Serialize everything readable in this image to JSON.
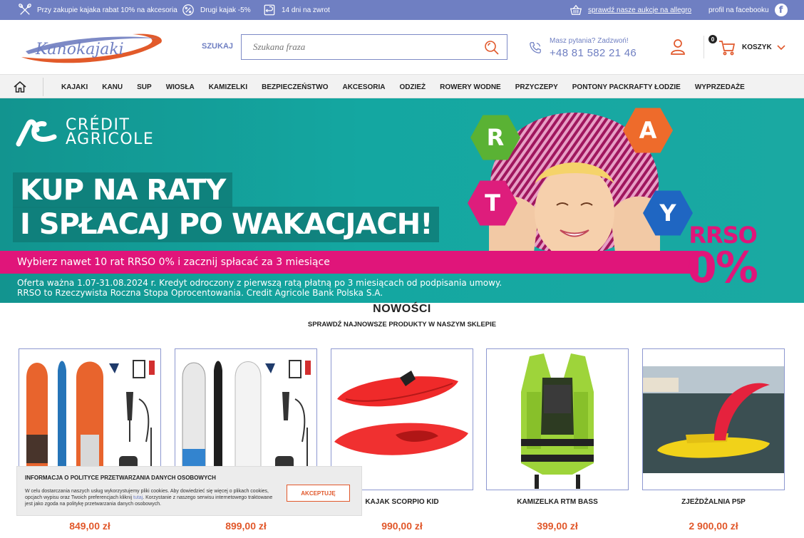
{
  "topbar": {
    "promo1": "Przy zakupie kajaka rabat 10% na akcesoria",
    "promo2": "Drugi kajak -5%",
    "promo3": "14 dni na zwrot",
    "allegro": "sprawdź nasze aukcje na allegro",
    "facebook": "profil na facebooku",
    "bg_color": "#6f7fc2"
  },
  "header": {
    "logo_text": "Kanokajaki",
    "search_label": "SZUKAJ",
    "search_placeholder": "Szukana fraza",
    "phone_question": "Masz pytania? Zadzwoń!",
    "phone_number": "+48 81 582 21 46",
    "cart_count": "0",
    "cart_label": "KOSZYK"
  },
  "nav": {
    "items": [
      "KAJAKI",
      "KANU",
      "SUP",
      "WIOSŁA",
      "KAMIZELKI",
      "BEZPIECZEŃSTWO",
      "AKCESORIA",
      "ODZIEŻ",
      "ROWERY WODNE",
      "PRZYCZEPY",
      "PONTONY PACKRAFTY ŁODZIE",
      "WYPRZEDAŻE"
    ]
  },
  "banner": {
    "brand_line1": "CRÉDIT",
    "brand_line2": "AGRICOLE",
    "headline1": "KUP NA RATY",
    "headline2": "I SPŁACAJ PO WAKACJACH!",
    "pink_text": "Wybierz nawet 10 rat RRSO 0% i zacznij spłacać za 3 miesiące",
    "fine_line1": "Oferta ważna 1.07-31.08.2024 r. Kredyt odroczony z pierwszą ratą płatną po 3 miesiącach od podpisania umowy.",
    "fine_line2": "RRSO to Rzeczywista Roczna Stopa Oprocentowania. Credit Agricole Bank Polska S.A.",
    "hex_letters": [
      "R",
      "A",
      "T",
      "Y"
    ],
    "rrso_label": "RRSO",
    "rrso_value": "0%"
  },
  "section": {
    "title": "NOWOŚCI",
    "subtitle": "SPRAWDŹ NAJNOWSZE PRODUKTY W NASZYM SKLEPIE"
  },
  "products": [
    {
      "name": "",
      "price": "849,00 zł"
    },
    {
      "name": "",
      "price": "899,00 zł"
    },
    {
      "name": "KAJAK SCORPIO KID",
      "price": "990,00 zł"
    },
    {
      "name": "KAMIZELKA RTM BASS",
      "price": "399,00 zł"
    },
    {
      "name": "ZJEŻDŻALNIA P5P",
      "price": "2 900,00 zł"
    }
  ],
  "cookie": {
    "title": "INFORMACJA O POLITYCE PRZETWARZANIA DANYCH OSOBOWYCH",
    "text_a": "W celu dostarczania naszych usług wykorzystujemy pliki cookies. Aby dowiedzieć się więcej o plikach cookies, opcjach wypisu oraz Twoich preferencjach kliknij ",
    "text_link": "tutaj",
    "text_b": ". Korzystanie z naszego serwisu internetowego traktowane jest jako zgoda na politykę przetwarzania danych osobowych.",
    "button": "AKCEPTUJĘ"
  },
  "colors": {
    "accent": "#6f7fc2",
    "price": "#e1582b",
    "banner_teal": "#14a7a1",
    "banner_pink": "#e0157a"
  }
}
